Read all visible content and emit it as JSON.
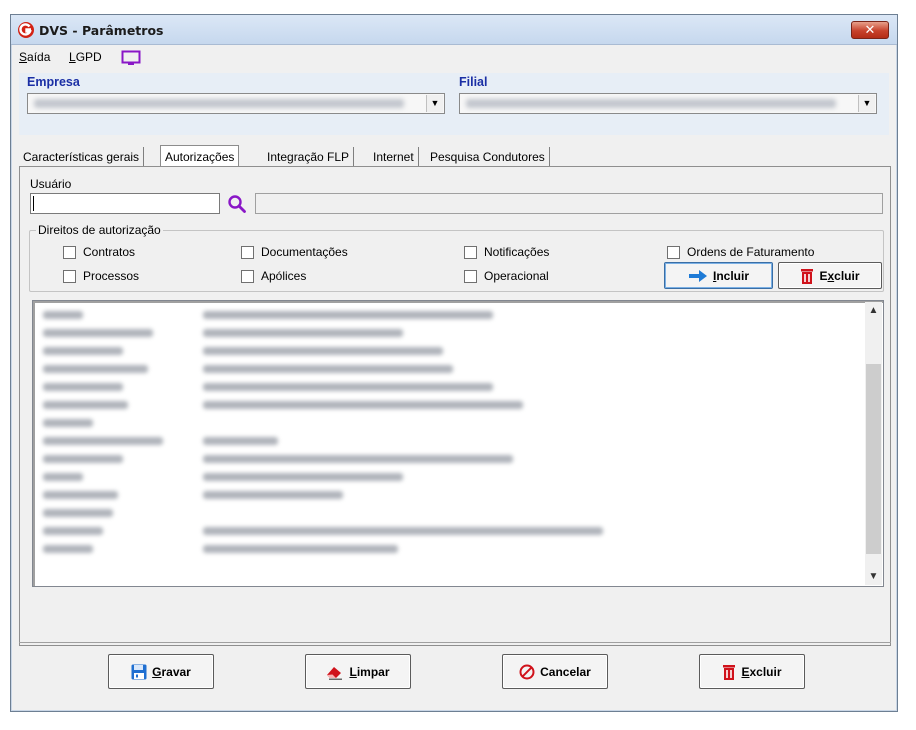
{
  "window": {
    "title": "DVS - Parâmetros",
    "close_symbol": "✕"
  },
  "menu": {
    "saida_pre": "S",
    "saida_post": "aída",
    "lgpd_pre": "L",
    "lgpd_post": "GPD",
    "monitor_icon": "monitor-icon"
  },
  "header": {
    "empresa_label": "Empresa",
    "filial_label": "Filial"
  },
  "tabs": [
    {
      "label": "Características gerais"
    },
    {
      "label": "Autorizações",
      "active": true
    },
    {
      "label": "Integração FLP"
    },
    {
      "label": "Internet"
    },
    {
      "label": "Pesquisa Condutores"
    }
  ],
  "usuario": {
    "label": "Usuário",
    "value": "",
    "description": ""
  },
  "direitos": {
    "title": "Direitos de autorização",
    "checkboxes": {
      "contratos": "Contratos",
      "processos": "Processos",
      "documentacoes": "Documentações",
      "apolices": "Apólices",
      "notificacoes": "Notificações",
      "operacional": "Operacional",
      "ordens": "Ordens de Faturamento"
    },
    "incluir_pre": "I",
    "incluir_post": "ncluir",
    "excluir_pre": "E",
    "excluir_u": "x",
    "excluir_post": "cluir"
  },
  "footer": {
    "gravar_pre": "G",
    "gravar_post": "ravar",
    "limpar_pre": "L",
    "limpar_post": "impar",
    "cancelar": "Cancelar",
    "excluir_pre": "E",
    "excluir_post": "xcluir"
  },
  "colors": {
    "accent_blue": "#1b2fa5",
    "search_purple": "#8a17c7",
    "delete_red": "#d0121b",
    "arrow_blue": "#1f7bd6"
  }
}
